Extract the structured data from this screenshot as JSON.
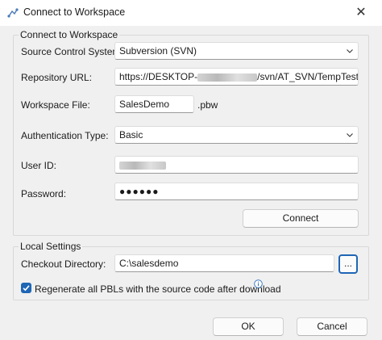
{
  "window": {
    "title": "Connect to Workspace",
    "close_glyph": "✕"
  },
  "workspace_group": {
    "legend": "Connect to Workspace",
    "source_control_label": "Source Control System:",
    "source_control_value": "Subversion (SVN)",
    "repo_url_label": "Repository URL:",
    "repo_url_prefix": "https://DESKTOP-",
    "repo_url_suffix": "/svn/AT_SVN/TempTest/Sale",
    "workspace_file_label": "Workspace File:",
    "workspace_file_value": "SalesDemo",
    "workspace_file_ext": ".pbw",
    "auth_type_label": "Authentication Type:",
    "auth_type_value": "Basic",
    "user_id_label": "User ID:",
    "password_label": "Password:",
    "password_value": "●●●●●●",
    "connect_button": "Connect"
  },
  "local_group": {
    "legend": "Local Settings",
    "checkout_dir_label": "Checkout Directory:",
    "checkout_dir_value": "C:\\salesdemo",
    "browse_button": "...",
    "regenerate_label": "Regenerate all PBLs with the source code after download",
    "regenerate_checked": true
  },
  "footer": {
    "ok_button": "OK",
    "cancel_button": "Cancel"
  },
  "icons": {
    "app": "workspace-connect-icon",
    "close": "close-icon",
    "chevron": "chevron-down-icon",
    "check": "checkmark-icon",
    "info": "info-icon"
  },
  "colors": {
    "accent": "#1f66b5",
    "focus_border": "#1f66b5"
  }
}
